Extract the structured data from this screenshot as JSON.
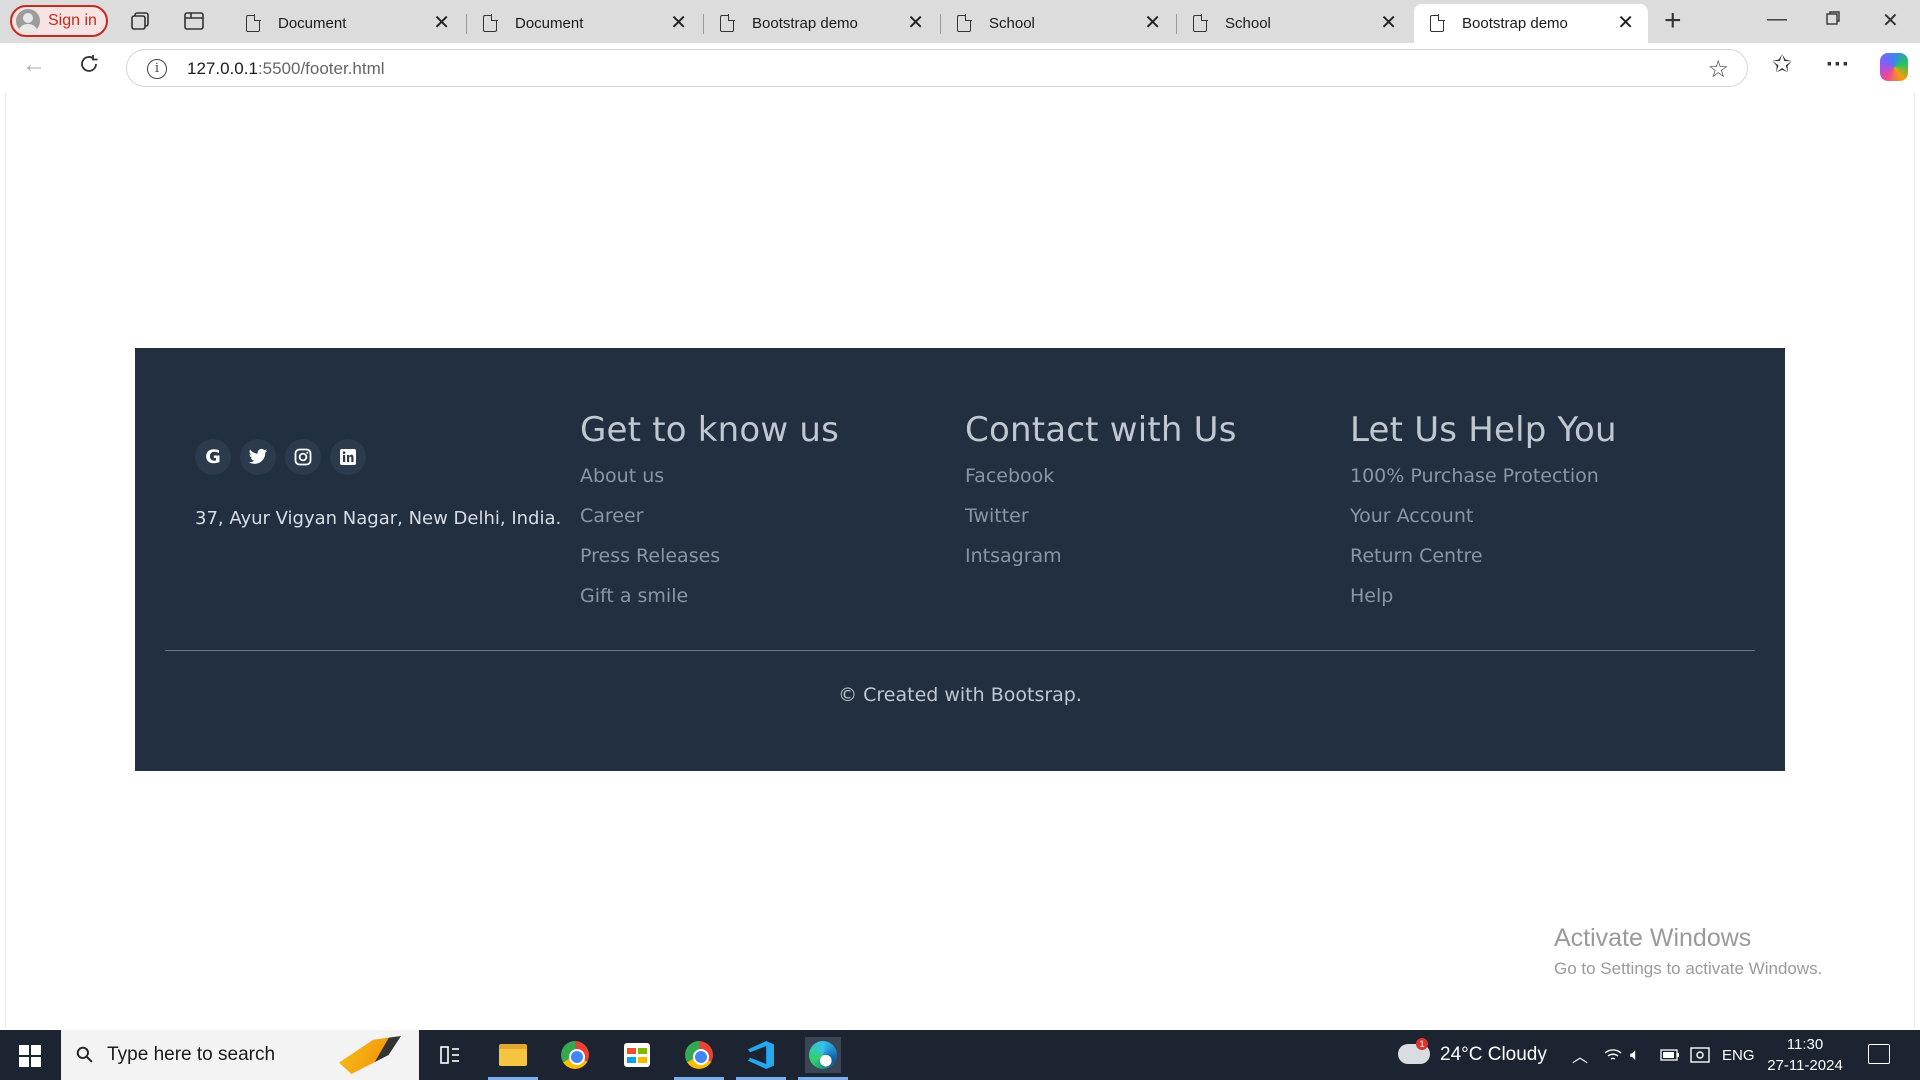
{
  "browser": {
    "signin_label": "Sign in",
    "tabs": [
      {
        "title": "Document"
      },
      {
        "title": "Document"
      },
      {
        "title": "Bootstrap demo"
      },
      {
        "title": "School"
      },
      {
        "title": "School"
      },
      {
        "title": "Bootstrap demo"
      }
    ],
    "url_host": "127.0.0.1",
    "url_path": ":5500/footer.html"
  },
  "footer": {
    "social_icons": [
      {
        "name": "google-icon",
        "glyph": "G"
      },
      {
        "name": "twitter-icon",
        "glyph": "🐦"
      },
      {
        "name": "instagram-icon",
        "glyph": "◎"
      },
      {
        "name": "linkedin-icon",
        "glyph": "in"
      }
    ],
    "address": "37, Ayur Vigyan Nagar, New Delhi, India.",
    "columns": [
      {
        "heading": "Get to know us",
        "links": [
          "About us",
          "Career",
          "Press Releases",
          "Gift a smile"
        ]
      },
      {
        "heading": "Contact with Us",
        "links": [
          "Facebook",
          "Twitter",
          "Intsagram"
        ]
      },
      {
        "heading": "Let Us Help You",
        "links": [
          "100% Purchase Protection",
          "Your Account",
          "Return Centre",
          "Help"
        ]
      }
    ],
    "copyright": "© Created with Bootsrap.",
    "colors": {
      "background": "#212f41",
      "heading": "#c0c7cf",
      "link": "#8a96a3"
    }
  },
  "watermark": {
    "title": "Activate Windows",
    "subtitle": "Go to Settings to activate Windows."
  },
  "taskbar": {
    "search_placeholder": "Type here to search",
    "weather": "24°C  Cloudy",
    "language": "ENG",
    "time": "11:30",
    "date": "27-11-2024",
    "weather_badge": "1"
  }
}
